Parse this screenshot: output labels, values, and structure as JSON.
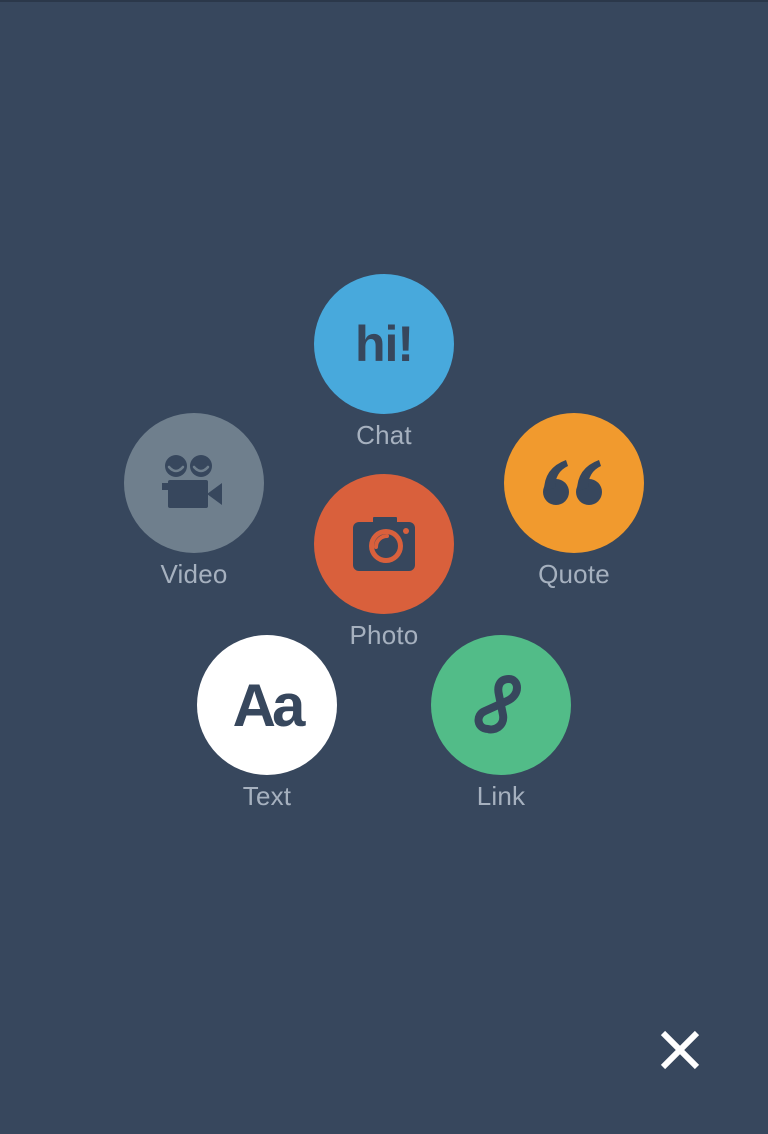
{
  "options": {
    "chat": {
      "label": "Chat",
      "glyph": "hi!",
      "icon": "chat-hi-icon",
      "color": "#48a9dc"
    },
    "video": {
      "label": "Video",
      "icon": "video-camera-icon",
      "color": "#6f7f8d"
    },
    "quote": {
      "label": "Quote",
      "icon": "quote-marks-icon",
      "color": "#f19a2e"
    },
    "photo": {
      "label": "Photo",
      "icon": "camera-icon",
      "color": "#d9603c"
    },
    "text": {
      "label": "Text",
      "glyph": "Aa",
      "icon": "text-aa-icon",
      "color": "#ffffff"
    },
    "link": {
      "label": "Link",
      "icon": "link-icon",
      "color": "#52bc88"
    }
  },
  "close": {
    "icon": "close-icon"
  },
  "colors": {
    "background": "#37475d",
    "icon_fg": "#37475d",
    "label": "#a6b1bf",
    "close": "#ffffff"
  }
}
